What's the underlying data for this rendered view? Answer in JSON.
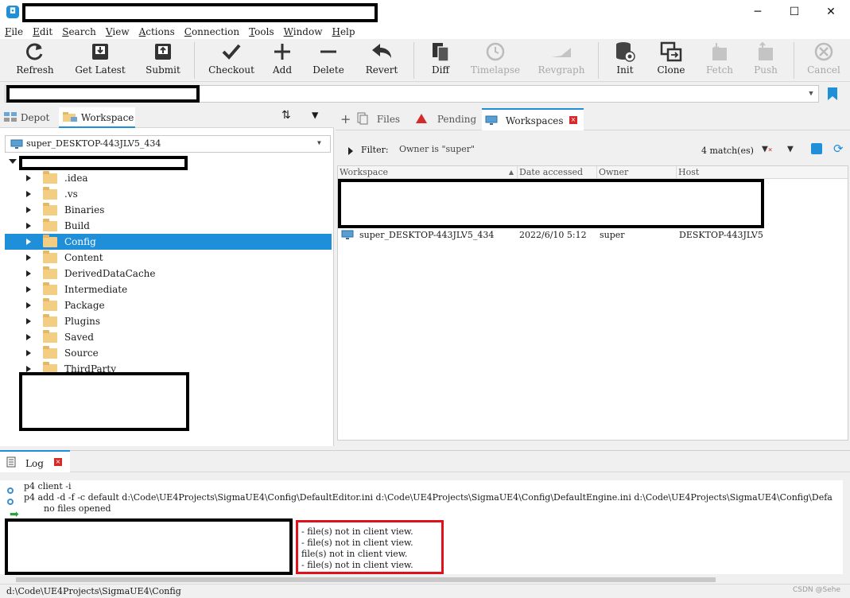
{
  "window": {
    "minimize_glyph": "─",
    "maximize_glyph": "☐",
    "close_glyph": "✕"
  },
  "menu": [
    {
      "key": "F",
      "rest": "ile"
    },
    {
      "key": "E",
      "rest": "dit"
    },
    {
      "key": "S",
      "rest": "earch"
    },
    {
      "key": "V",
      "rest": "iew"
    },
    {
      "key": "A",
      "rest": "ctions"
    },
    {
      "key": "C",
      "rest": "onnection"
    },
    {
      "key": "T",
      "rest": "ools"
    },
    {
      "key": "W",
      "rest": "indow"
    },
    {
      "key": "H",
      "rest": "elp"
    }
  ],
  "toolbar": {
    "refresh": "Refresh",
    "get_latest": "Get Latest",
    "submit": "Submit",
    "checkout": "Checkout",
    "add": "Add",
    "delete": "Delete",
    "revert": "Revert",
    "diff": "Diff",
    "timelapse": "Timelapse",
    "revgraph": "Revgraph",
    "init": "Init",
    "clone": "Clone",
    "fetch": "Fetch",
    "push": "Push",
    "cancel": "Cancel"
  },
  "left_tabs": {
    "depot": "Depot",
    "workspace": "Workspace"
  },
  "workspace_select": "super_DESKTOP-443JLV5_434",
  "tree": [
    ".idea",
    ".vs",
    "Binaries",
    "Build",
    "Config",
    "Content",
    "DerivedDataCache",
    "Intermediate",
    "Package",
    "Plugins",
    "Saved",
    "Source",
    "ThirdParty"
  ],
  "right_tabs": {
    "files": "Files",
    "pending": "Pending",
    "workspaces": "Workspaces"
  },
  "filter": {
    "label": "Filter:",
    "text": "Owner is \"super\"",
    "matches": "4 match(es)"
  },
  "grid": {
    "headers": [
      "Workspace",
      "Date accessed",
      "Owner",
      "Host"
    ],
    "row": {
      "workspace": "super_DESKTOP-443JLV5_434",
      "date": "2022/6/10 5:12",
      "owner": "super",
      "host": "DESKTOP-443JLV5"
    }
  },
  "log": {
    "tab": "Log",
    "line1": "p4 client -i",
    "line2": "p4 add -d -f -c default d:\\Code\\UE4Projects\\SigmaUE4\\Config\\DefaultEditor.ini d:\\Code\\UE4Projects\\SigmaUE4\\Config\\DefaultEngine.ini d:\\Code\\UE4Projects\\SigmaUE4\\Config\\Defa",
    "line3": "no files opened",
    "red_lines": [
      "- file(s) not in client view.",
      "- file(s) not in client view.",
      "file(s) not in client view.",
      "- file(s) not in client view."
    ]
  },
  "status": "d:\\Code\\UE4Projects\\SigmaUE4\\Config",
  "watermark": "CSDN @Sehe",
  "colors": {
    "accent": "#1e8fd8",
    "highlight": "#e0101d"
  }
}
